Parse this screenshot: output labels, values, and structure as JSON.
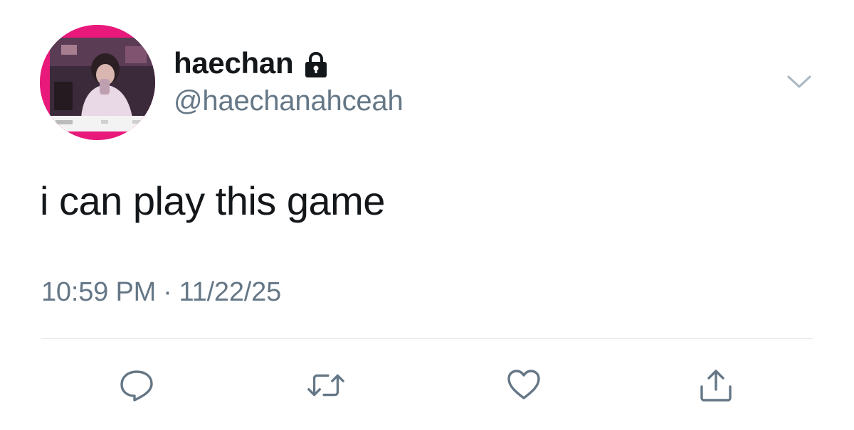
{
  "user": {
    "display_name": "haechan",
    "handle": "@haechanahceah",
    "protected_icon": "lock-icon",
    "avatar_icon": "avatar-photo"
  },
  "tweet": {
    "text": "i can play this game",
    "time": "10:59 PM",
    "separator": "·",
    "date": "11/22/25"
  },
  "menu": {
    "icon": "chevron-down-icon"
  },
  "actions": [
    {
      "name": "reply",
      "icon": "speech-bubble-icon"
    },
    {
      "name": "retweet",
      "icon": "retweet-arrows-icon"
    },
    {
      "name": "like",
      "icon": "heart-icon"
    },
    {
      "name": "share",
      "icon": "share-upload-icon"
    }
  ],
  "colors": {
    "text_primary": "#14171a",
    "text_secondary": "#657786",
    "icon_gray": "#657786",
    "divider": "#e1e8ed",
    "avatar_accent": "#e8197a"
  }
}
